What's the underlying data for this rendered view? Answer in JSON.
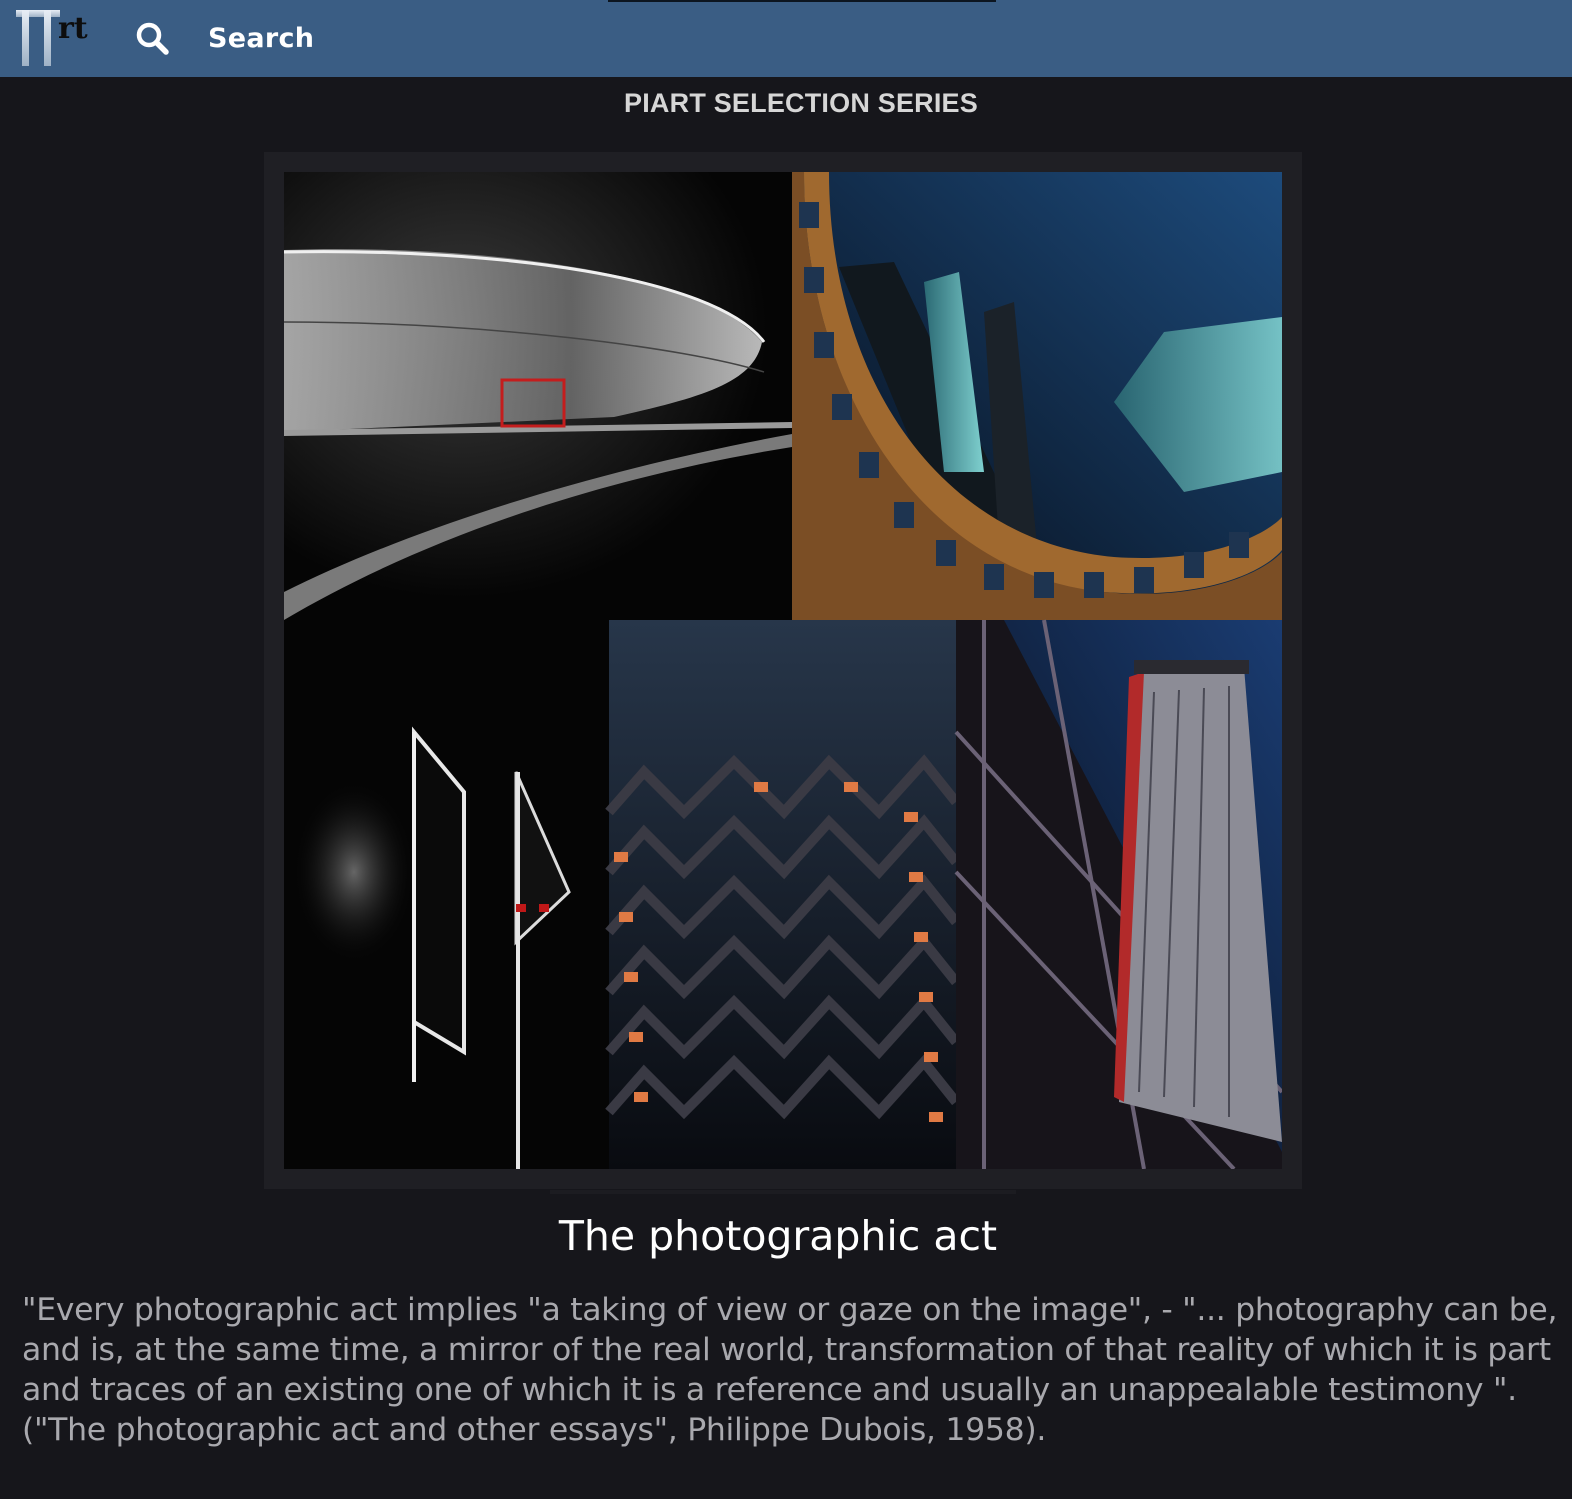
{
  "header": {
    "logo_text": "Πrt",
    "search_label": "Search",
    "icons": {
      "search": "search-icon"
    },
    "colors": {
      "bar": "#3a5d84",
      "text": "#ffffff"
    }
  },
  "series": {
    "title": "PIART SELECTION SERIES"
  },
  "artwork": {
    "title": "The photographic act",
    "description": "\"Every photographic act implies \"a taking of view or gaze on the image\", - \"... photography can be, and is, at the same time, a mirror of the real world, transformation of that reality of which it is part and traces of an existing one of which it is a reference and usually an unappealable testimony \". (\"The photographic act and other essays\", Philippe Dubois, 1958)."
  },
  "theme": {
    "background": "#16161b",
    "frame": "#1f1f24",
    "quote_text": "#a9a9ae"
  }
}
